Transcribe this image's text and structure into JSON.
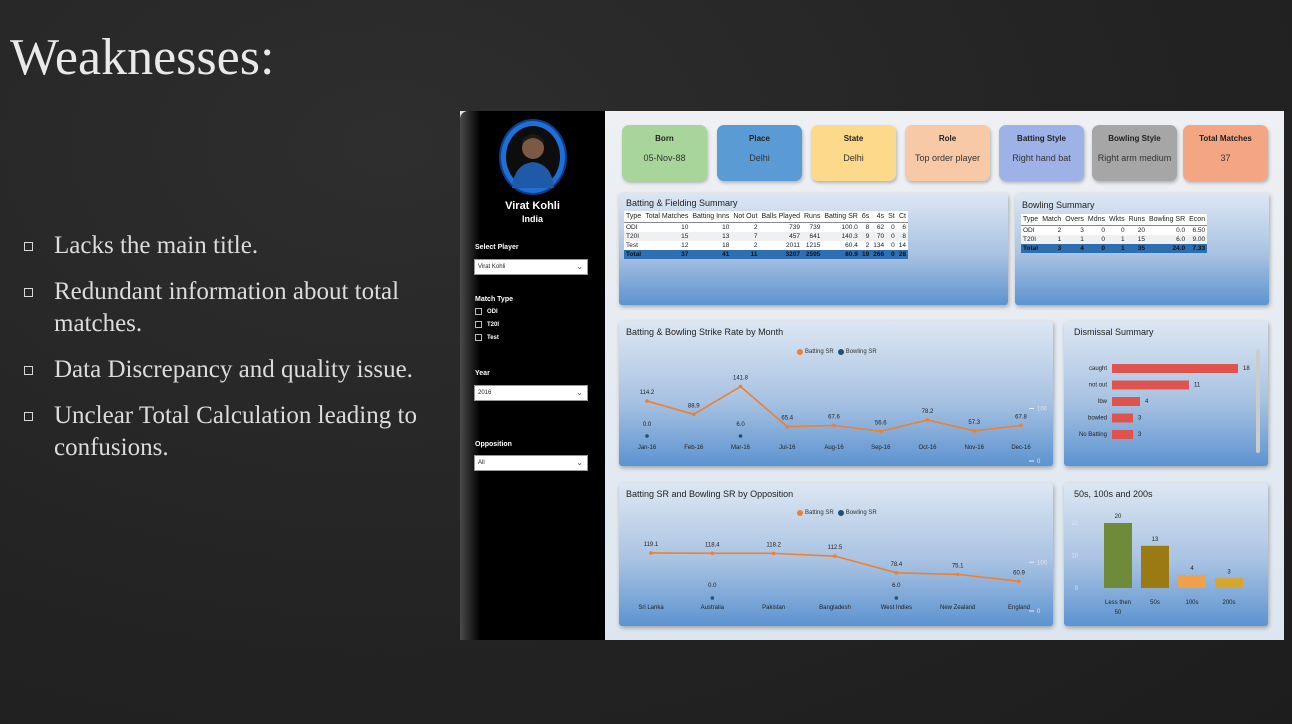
{
  "slide": {
    "title": "Weaknesses:",
    "bullets": [
      "Lacks the main title.",
      "Redundant information about total matches.",
      "Data Discrepancy and quality issue.",
      "Unclear Total Calculation leading to confusions."
    ]
  },
  "sidebar": {
    "player_name": "Virat Kohli",
    "country": "India",
    "select_player_label": "Select Player",
    "select_player_value": "Virat Kohli",
    "match_type_label": "Match Type",
    "match_types": [
      "ODI",
      "T20I",
      "Test"
    ],
    "year_label": "Year",
    "year_value": "2016",
    "opposition_label": "Opposition",
    "opposition_value": "All"
  },
  "cards": [
    {
      "title": "Born",
      "value": "05-Nov-88",
      "color": "#a8d69a"
    },
    {
      "title": "Place",
      "value": "Delhi",
      "color": "#5b9bd5"
    },
    {
      "title": "State",
      "value": "Delhi",
      "color": "#fdd98b"
    },
    {
      "title": "Role",
      "value": "Top order player",
      "color": "#f8c9a6"
    },
    {
      "title": "Batting Style",
      "value": "Right hand bat",
      "color": "#9fb2e8"
    },
    {
      "title": "Bowling Style",
      "value": "Right arm medium",
      "color": "#a6a6a6"
    },
    {
      "title": "Total Matches",
      "value": "37",
      "color": "#f4a583"
    }
  ],
  "batting_summary": {
    "title": "Batting & Fielding Summary",
    "columns": [
      "Type",
      "Total Matches",
      "Batting Inns",
      "Not Out",
      "Balls Played",
      "Runs",
      "Batting SR",
      "6s",
      "4s",
      "St",
      "Ct"
    ],
    "rows": [
      [
        "ODI",
        "10",
        "10",
        "2",
        "739",
        "739",
        "100.0",
        "8",
        "62",
        "0",
        "6"
      ],
      [
        "T20I",
        "15",
        "13",
        "7",
        "457",
        "641",
        "140.3",
        "9",
        "70",
        "0",
        "8"
      ],
      [
        "Test",
        "12",
        "18",
        "2",
        "2011",
        "1215",
        "60.4",
        "2",
        "134",
        "0",
        "14"
      ]
    ],
    "total": [
      "Total",
      "37",
      "41",
      "11",
      "3207",
      "2595",
      "80.9",
      "19",
      "266",
      "0",
      "28"
    ]
  },
  "bowling_summary": {
    "title": "Bowling Summary",
    "columns": [
      "Type",
      "Match",
      "Overs",
      "Mdns",
      "Wkts",
      "Runs",
      "Bowling SR",
      "Econ"
    ],
    "rows": [
      [
        "ODI",
        "2",
        "3",
        "0",
        "0",
        "20",
        "0.0",
        "6.50"
      ],
      [
        "T20I",
        "1",
        "1",
        "0",
        "1",
        "15",
        "6.0",
        "9.00"
      ]
    ],
    "total": [
      "Total",
      "3",
      "4",
      "0",
      "1",
      "35",
      "24.0",
      "7.33"
    ]
  },
  "colors": {
    "batting": "#f07f2e",
    "bowling": "#1f4e79",
    "bar_red": "#e0524e"
  },
  "chart_data": [
    {
      "type": "line",
      "title": "Batting & Bowling Strike Rate by Month",
      "categories": [
        "Jan-16",
        "Feb-16",
        "Mar-16",
        "Jul-16",
        "Aug-16",
        "Sep-16",
        "Oct-16",
        "Nov-16",
        "Dec-16"
      ],
      "series": [
        {
          "name": "Batting SR",
          "values": [
            114.2,
            88.9,
            141.8,
            65.4,
            67.6,
            56.6,
            78.2,
            57.3,
            67.8
          ]
        },
        {
          "name": "Bowling SR",
          "values": [
            0.0,
            null,
            6.0,
            null,
            null,
            null,
            null,
            null,
            null
          ]
        }
      ],
      "y_ticks": [
        "100",
        "0"
      ]
    },
    {
      "type": "bar",
      "title": "Dismissal Summary",
      "categories": [
        "caught",
        "not out",
        "lbw",
        "bowled",
        "No Batting"
      ],
      "values": [
        18,
        11,
        4,
        3,
        3
      ]
    },
    {
      "type": "line",
      "title": "Batting SR and Bowling SR by Opposition",
      "categories": [
        "Sri Lanka",
        "Australia",
        "Pakistan",
        "Bangladesh",
        "West Indies",
        "New Zealand",
        "England"
      ],
      "series": [
        {
          "name": "Batting SR",
          "values": [
            119.1,
            118.4,
            118.2,
            112.5,
            78.4,
            75.1,
            60.9
          ]
        },
        {
          "name": "Bowling SR",
          "values": [
            null,
            0.0,
            null,
            null,
            6.0,
            null,
            null
          ]
        }
      ],
      "y_ticks": [
        "100",
        "0"
      ]
    },
    {
      "type": "bar",
      "title": "50s, 100s and 200s",
      "categories": [
        "Less then 50",
        "50s",
        "100s",
        "200s"
      ],
      "values": [
        20,
        13,
        4,
        3
      ],
      "colors": [
        "#6f8b3a",
        "#9b7a14",
        "#f0a04b",
        "#d9a62b"
      ],
      "y_ticks": [
        "20",
        "10",
        "0"
      ]
    }
  ]
}
